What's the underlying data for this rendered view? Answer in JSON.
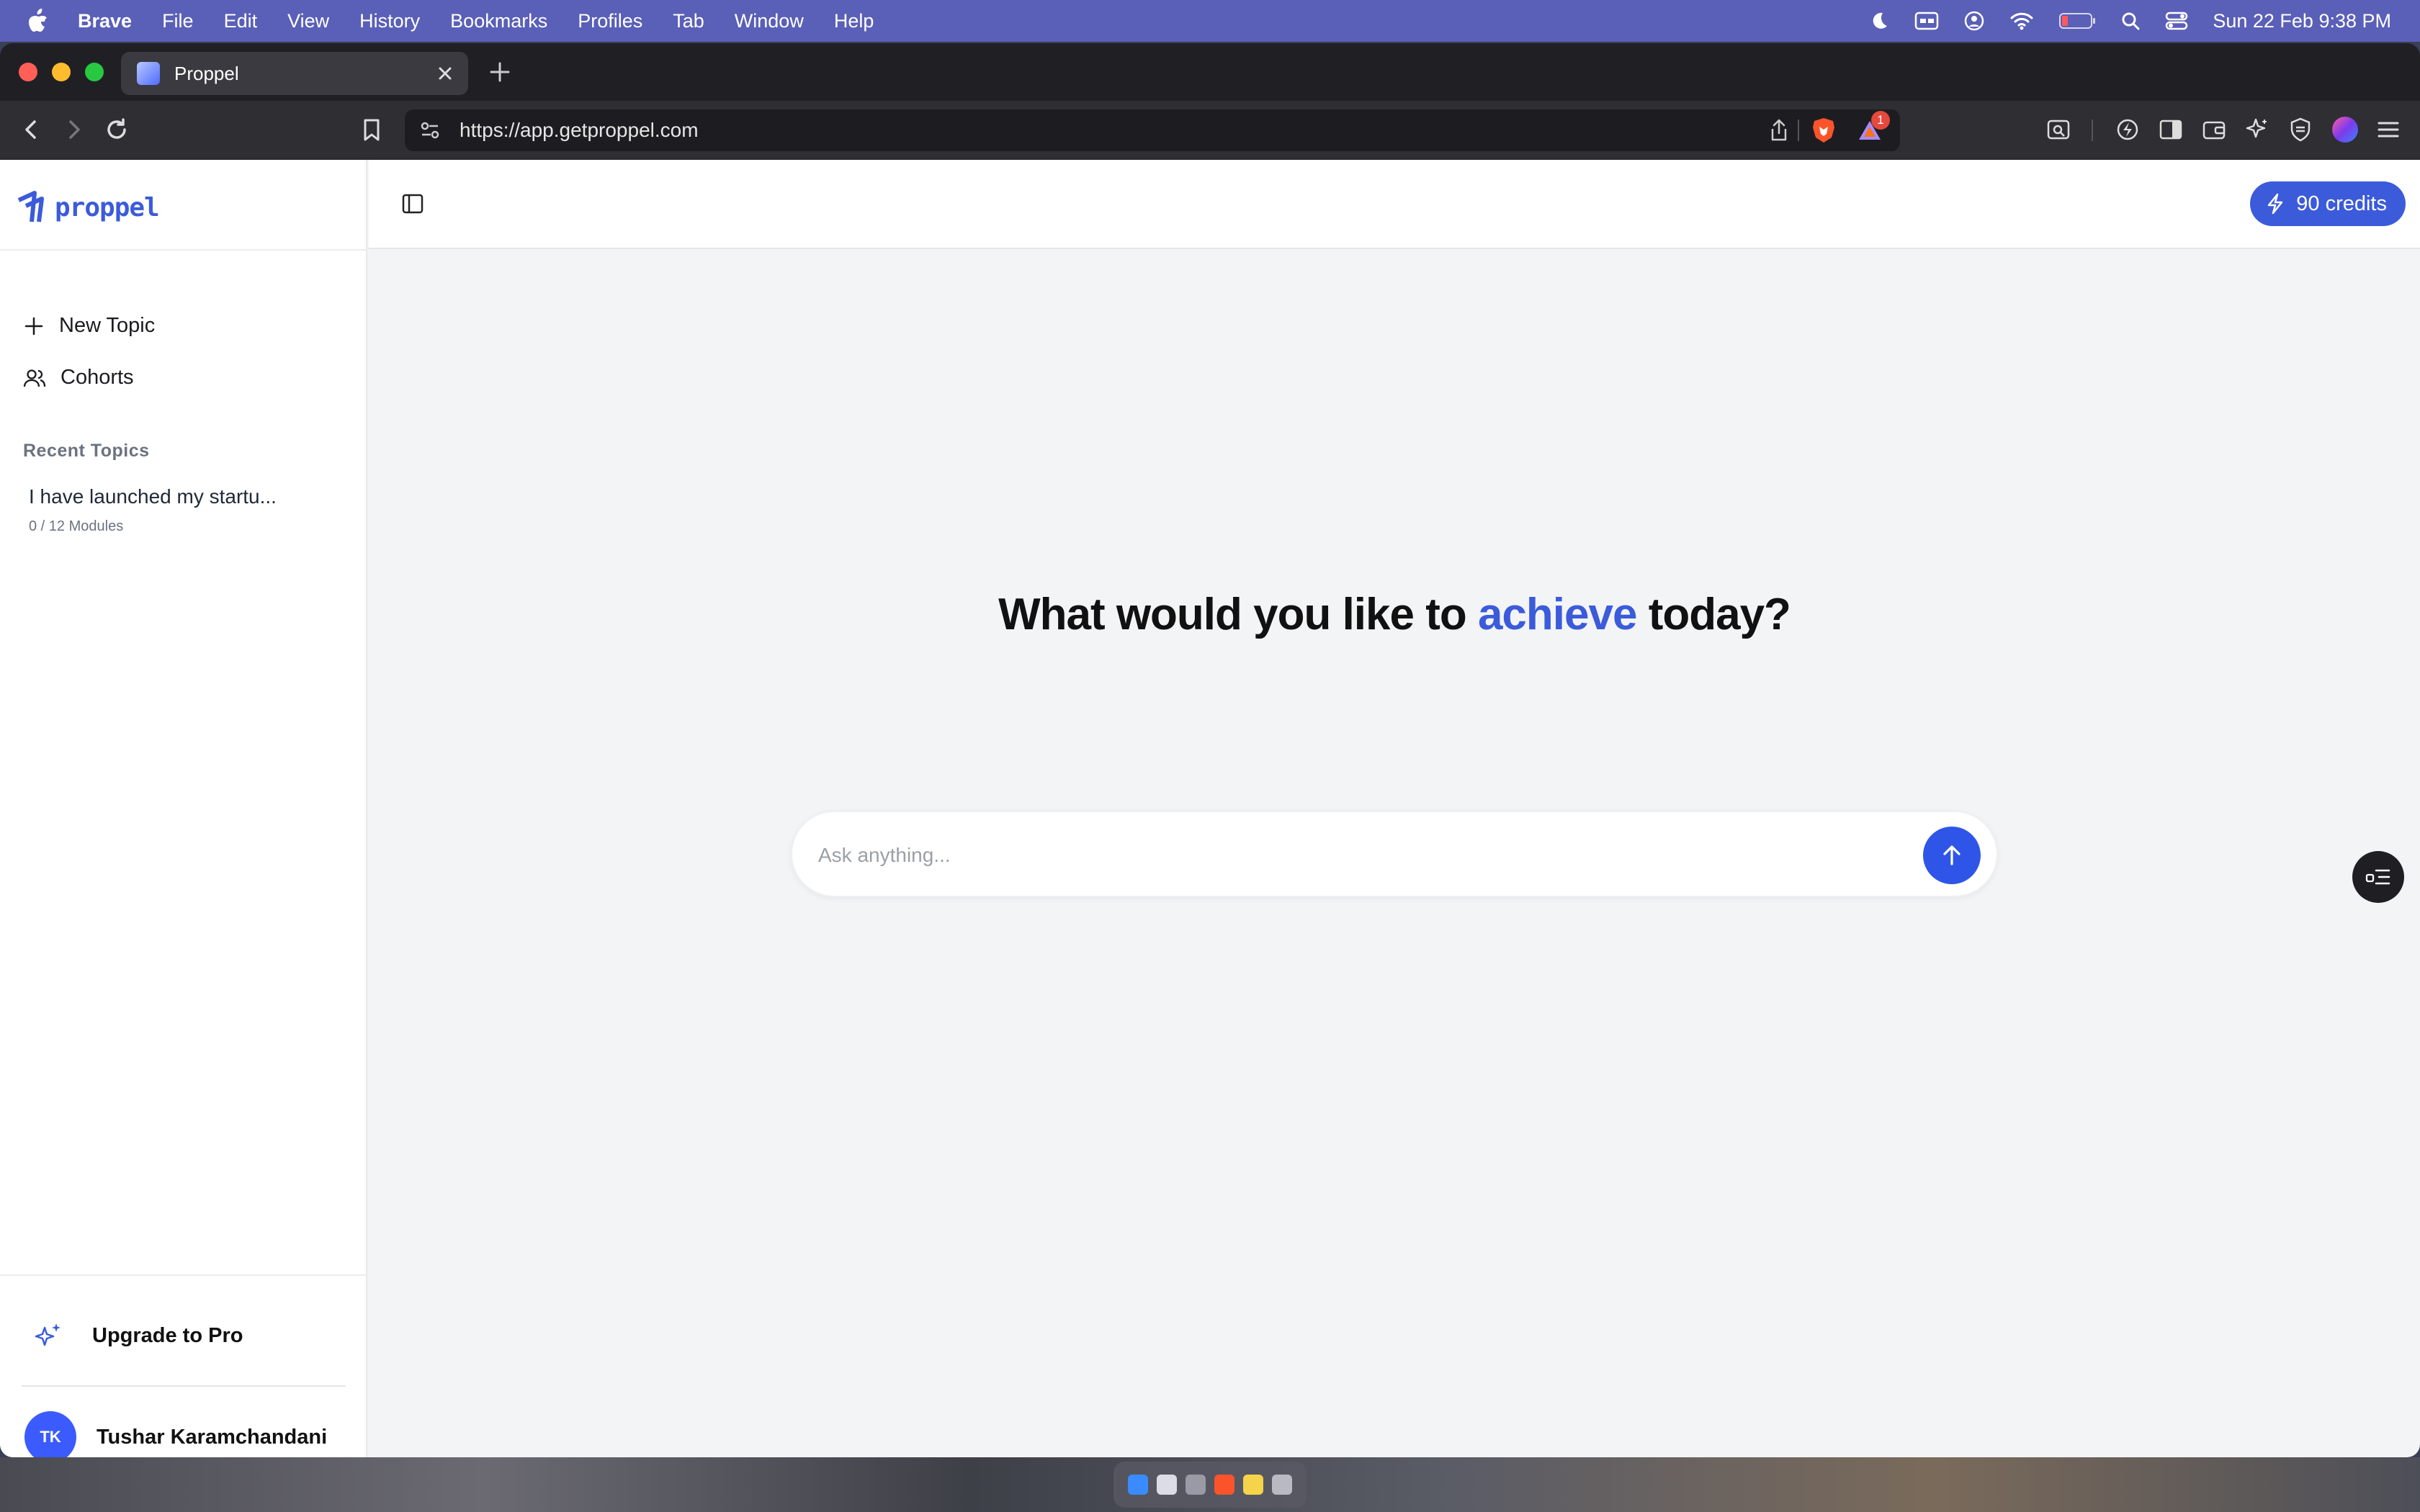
{
  "menubar": {
    "app_name": "Brave",
    "items": [
      "File",
      "Edit",
      "View",
      "History",
      "Bookmarks",
      "Profiles",
      "Tab",
      "Window",
      "Help"
    ],
    "datetime": "Sun 22 Feb  9:38 PM"
  },
  "browser": {
    "tab_title": "Proppel",
    "url": "https://app.getproppel.com",
    "notification_count": "1"
  },
  "sidebar": {
    "logo_text": "proppel",
    "nav": [
      {
        "label": "New Topic",
        "icon": "plus-icon"
      },
      {
        "label": "Cohorts",
        "icon": "users-icon"
      }
    ],
    "recent_label": "Recent Topics",
    "recent_topics": [
      {
        "title": "I have launched my startu...",
        "progress": "0 / 12 Modules"
      }
    ],
    "upgrade_label": "Upgrade to Pro",
    "user": {
      "initials": "TK",
      "name": "Tushar Karamchandani"
    }
  },
  "topbar": {
    "credits_label": "90 credits"
  },
  "main": {
    "headline_before": "What would you like to ",
    "headline_accent": "achieve",
    "headline_after": " today?",
    "ask_placeholder": "Ask anything..."
  },
  "colors": {
    "brand": "#3b5bdb",
    "menubar": "#5a5fb7",
    "send_button": "#2f55e8"
  }
}
